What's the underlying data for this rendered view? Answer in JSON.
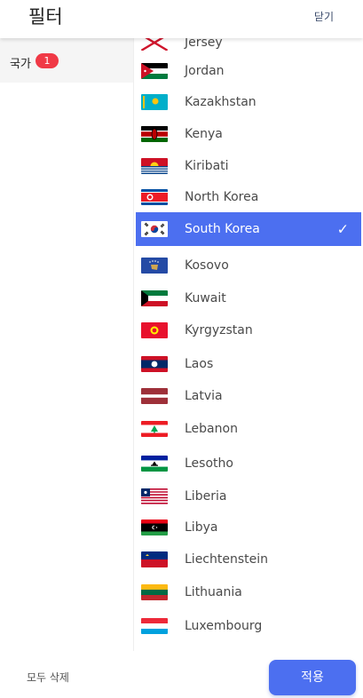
{
  "header": {
    "title": "필터",
    "close_label": "닫기"
  },
  "sidebar": {
    "items": [
      {
        "label": "국가",
        "badge": "1"
      }
    ]
  },
  "countries": [
    {
      "name": "Jersey",
      "flag": "jersey"
    },
    {
      "name": "Jordan",
      "flag": "jordan"
    },
    {
      "name": "Kazakhstan",
      "flag": "kazakhstan"
    },
    {
      "name": "Kenya",
      "flag": "kenya"
    },
    {
      "name": "Kiribati",
      "flag": "kiribati"
    },
    {
      "name": "North Korea",
      "flag": "north-korea"
    },
    {
      "name": "South Korea",
      "flag": "south-korea",
      "selected": true
    },
    {
      "name": "Kosovo",
      "flag": "kosovo"
    },
    {
      "name": "Kuwait",
      "flag": "kuwait"
    },
    {
      "name": "Kyrgyzstan",
      "flag": "kyrgyzstan"
    },
    {
      "name": "Laos",
      "flag": "laos"
    },
    {
      "name": "Latvia",
      "flag": "latvia"
    },
    {
      "name": "Lebanon",
      "flag": "lebanon"
    },
    {
      "name": "Lesotho",
      "flag": "lesotho"
    },
    {
      "name": "Liberia",
      "flag": "liberia"
    },
    {
      "name": "Libya",
      "flag": "libya"
    },
    {
      "name": "Liechtenstein",
      "flag": "liechtenstein"
    },
    {
      "name": "Lithuania",
      "flag": "lithuania"
    },
    {
      "name": "Luxembourg",
      "flag": "luxembourg"
    }
  ],
  "footer": {
    "clear_label": "모두 삭제",
    "apply_label": "적용"
  },
  "colors": {
    "accent": "#4c6ff0",
    "badge": "#f03946"
  }
}
